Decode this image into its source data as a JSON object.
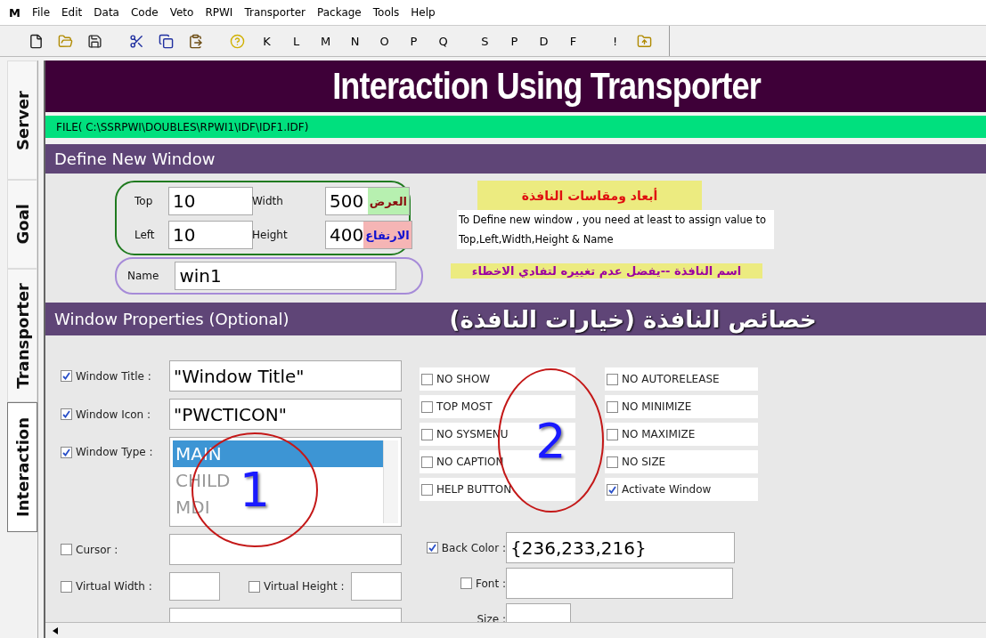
{
  "menu_bar": {
    "logo": "M",
    "items": [
      "File",
      "Edit",
      "Data",
      "Code",
      "Veto",
      "RPWI",
      "Transporter",
      "Package",
      "Tools",
      "Help"
    ]
  },
  "toolbar": {
    "items": [
      {
        "kind": "icon"
      },
      {
        "kind": "icon"
      },
      {
        "kind": "icon"
      },
      {
        "kind": "gap"
      },
      {
        "kind": "icon"
      },
      {
        "kind": "icon"
      },
      {
        "kind": "icon"
      },
      {
        "kind": "gap"
      },
      {
        "kind": "icon"
      },
      {
        "kind": "letter",
        "label": "K"
      },
      {
        "kind": "letter",
        "label": "L"
      },
      {
        "kind": "letter",
        "label": "M"
      },
      {
        "kind": "letter",
        "label": "N"
      },
      {
        "kind": "letter",
        "label": "O"
      },
      {
        "kind": "letter",
        "label": "P"
      },
      {
        "kind": "letter",
        "label": "Q"
      },
      {
        "kind": "gap"
      },
      {
        "kind": "letter",
        "label": "S"
      },
      {
        "kind": "letter",
        "label": "P"
      },
      {
        "kind": "letter",
        "label": "D"
      },
      {
        "kind": "letter",
        "label": "F"
      },
      {
        "kind": "gap"
      },
      {
        "kind": "letter",
        "label": "!"
      },
      {
        "kind": "icon"
      }
    ]
  },
  "side_tabs": [
    {
      "label": "Server",
      "selected": false
    },
    {
      "label": "Goal",
      "selected": false
    },
    {
      "label": "Transporter",
      "selected": false
    },
    {
      "label": "Interaction",
      "selected": true
    }
  ],
  "banner": {
    "title": "Interaction Using Transporter"
  },
  "file_bar": {
    "path": "FILE( C:\\SSRPWI\\DOUBLES\\RPWI1\\IDF\\IDF1.IDF)"
  },
  "define_section": {
    "title": "Define New Window",
    "fields": [
      {
        "label": "Top",
        "value": "10"
      },
      {
        "label": "Width",
        "value": "500",
        "note": "العرض"
      },
      {
        "label": "Left",
        "value": "10"
      },
      {
        "label": "Height",
        "value": "400",
        "note": "الارتفاع"
      }
    ],
    "name": {
      "label": "Name",
      "value": "win1"
    },
    "dimensions_note": "أبعاد ومقاسات النافذة",
    "hint": "To Define new window , you need at least to assign value to Top,Left,Width,Height & Name",
    "name_note": "اسم النافذة  --يفضل عدم تغييره لتفادي الاخطاء"
  },
  "properties_section": {
    "title": "Window Properties (Optional)",
    "arabic_title": "خصائص النافذة (خيارات النافذة)",
    "text_fields": [
      {
        "label": "Window Title :",
        "checked": true,
        "value": "\"Window Title\""
      },
      {
        "label": "Window Icon :",
        "checked": true,
        "value": "\"PWCTICON\""
      }
    ],
    "window_type": {
      "label": "Window Type :",
      "checked": true,
      "options": [
        {
          "label": "MAIN",
          "selected": true
        },
        {
          "label": "CHILD",
          "selected": false
        },
        {
          "label": "MDI",
          "selected": false
        }
      ]
    },
    "cursor": {
      "label": "Cursor :",
      "checked": false
    },
    "virtual_width": {
      "label": "Virtual Width :",
      "checked": false
    },
    "virtual_height": {
      "label": "Virtual Height :",
      "checked": false
    },
    "flags": [
      {
        "label": "NO SHOW",
        "checked": false
      },
      {
        "label": "NO AUTORELEASE",
        "checked": false
      },
      {
        "label": "TOP MOST",
        "checked": false
      },
      {
        "label": "NO MINIMIZE",
        "checked": false
      },
      {
        "label": "NO SYSMENU",
        "checked": false
      },
      {
        "label": "NO MAXIMIZE",
        "checked": false
      },
      {
        "label": "NO CAPTION",
        "checked": false
      },
      {
        "label": "NO SIZE",
        "checked": false
      },
      {
        "label": "HELP BUTTON",
        "checked": false
      },
      {
        "label": "Activate Window",
        "checked": true
      }
    ],
    "back_color": {
      "label": "Back Color :",
      "checked": true,
      "value": "{236,233,216}"
    },
    "font": {
      "label": "Font :",
      "checked": false
    },
    "size": {
      "label": "Size :"
    }
  },
  "annotations": [
    {
      "number": "1"
    },
    {
      "number": "2"
    }
  ]
}
